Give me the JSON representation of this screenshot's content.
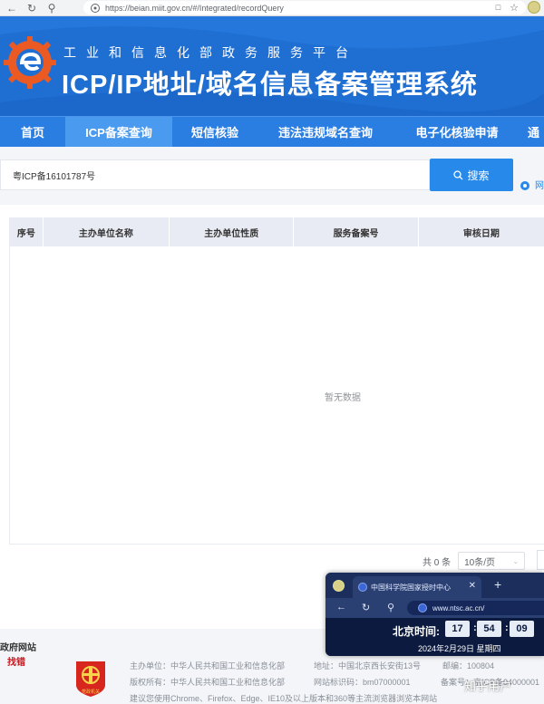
{
  "browser": {
    "url": "https://beian.miit.gov.cn/#/Integrated/recordQuery"
  },
  "header": {
    "subtitle": "工业和信息化部政务服务平台",
    "title": "ICP/IP地址/域名信息备案管理系统"
  },
  "menu": {
    "items": [
      {
        "label": "首页",
        "active": false
      },
      {
        "label": "ICP备案查询",
        "active": true
      },
      {
        "label": "短信核验",
        "active": false
      },
      {
        "label": "违法违规域名查询",
        "active": false
      },
      {
        "label": "电子化核验申请",
        "active": false
      },
      {
        "label": "通",
        "active": false
      }
    ]
  },
  "search": {
    "value": "粤ICP备16101787号",
    "button_label": "搜索",
    "option_label": "网"
  },
  "table": {
    "columns": [
      "序号",
      "主办单位名称",
      "主办单位性质",
      "服务备案号",
      "审核日期"
    ],
    "empty_text": "暂无数据"
  },
  "pagination": {
    "total_text": "共 0 条",
    "page_size": "10条/页"
  },
  "footer": {
    "gov_site": "政府网站",
    "gov_error": "找错",
    "emblem_text": "党政机关",
    "sponsor": "主办单位：中华人民共和国工业和信息化部",
    "address": "地址：中国北京西长安街13号",
    "postcode": "邮编：100804",
    "copyright": "版权所有：中华人民共和国工业和信息化部",
    "site_code": "网站标识码：bm07000001",
    "record_no": "备案号：京ICP备04000001",
    "browser_hint": "建议您使用Chrome、Firefox、Edge、IE10及以上版本和360等主流浏览器浏览本网站"
  },
  "floating_window": {
    "tab_title": "中国科学院国家授时中心",
    "url": "www.ntsc.ac.cn/",
    "label": "北京时间:",
    "hour": "17",
    "minute": "54",
    "second": "09",
    "date": "2024年2月29日 星期四"
  },
  "watermark": "知乎用户",
  "colors": {
    "header_blue": "#1f6fd3",
    "menu_blue": "#2a7de1",
    "active_tab": "#4a9af0",
    "search_button": "#2789ea"
  },
  "icons": [
    "back-icon",
    "reload-icon",
    "search-icon",
    "lock-icon",
    "extension-icon",
    "star-icon",
    "logo-icon",
    "emblem-icon",
    "plus-icon",
    "close-icon"
  ]
}
